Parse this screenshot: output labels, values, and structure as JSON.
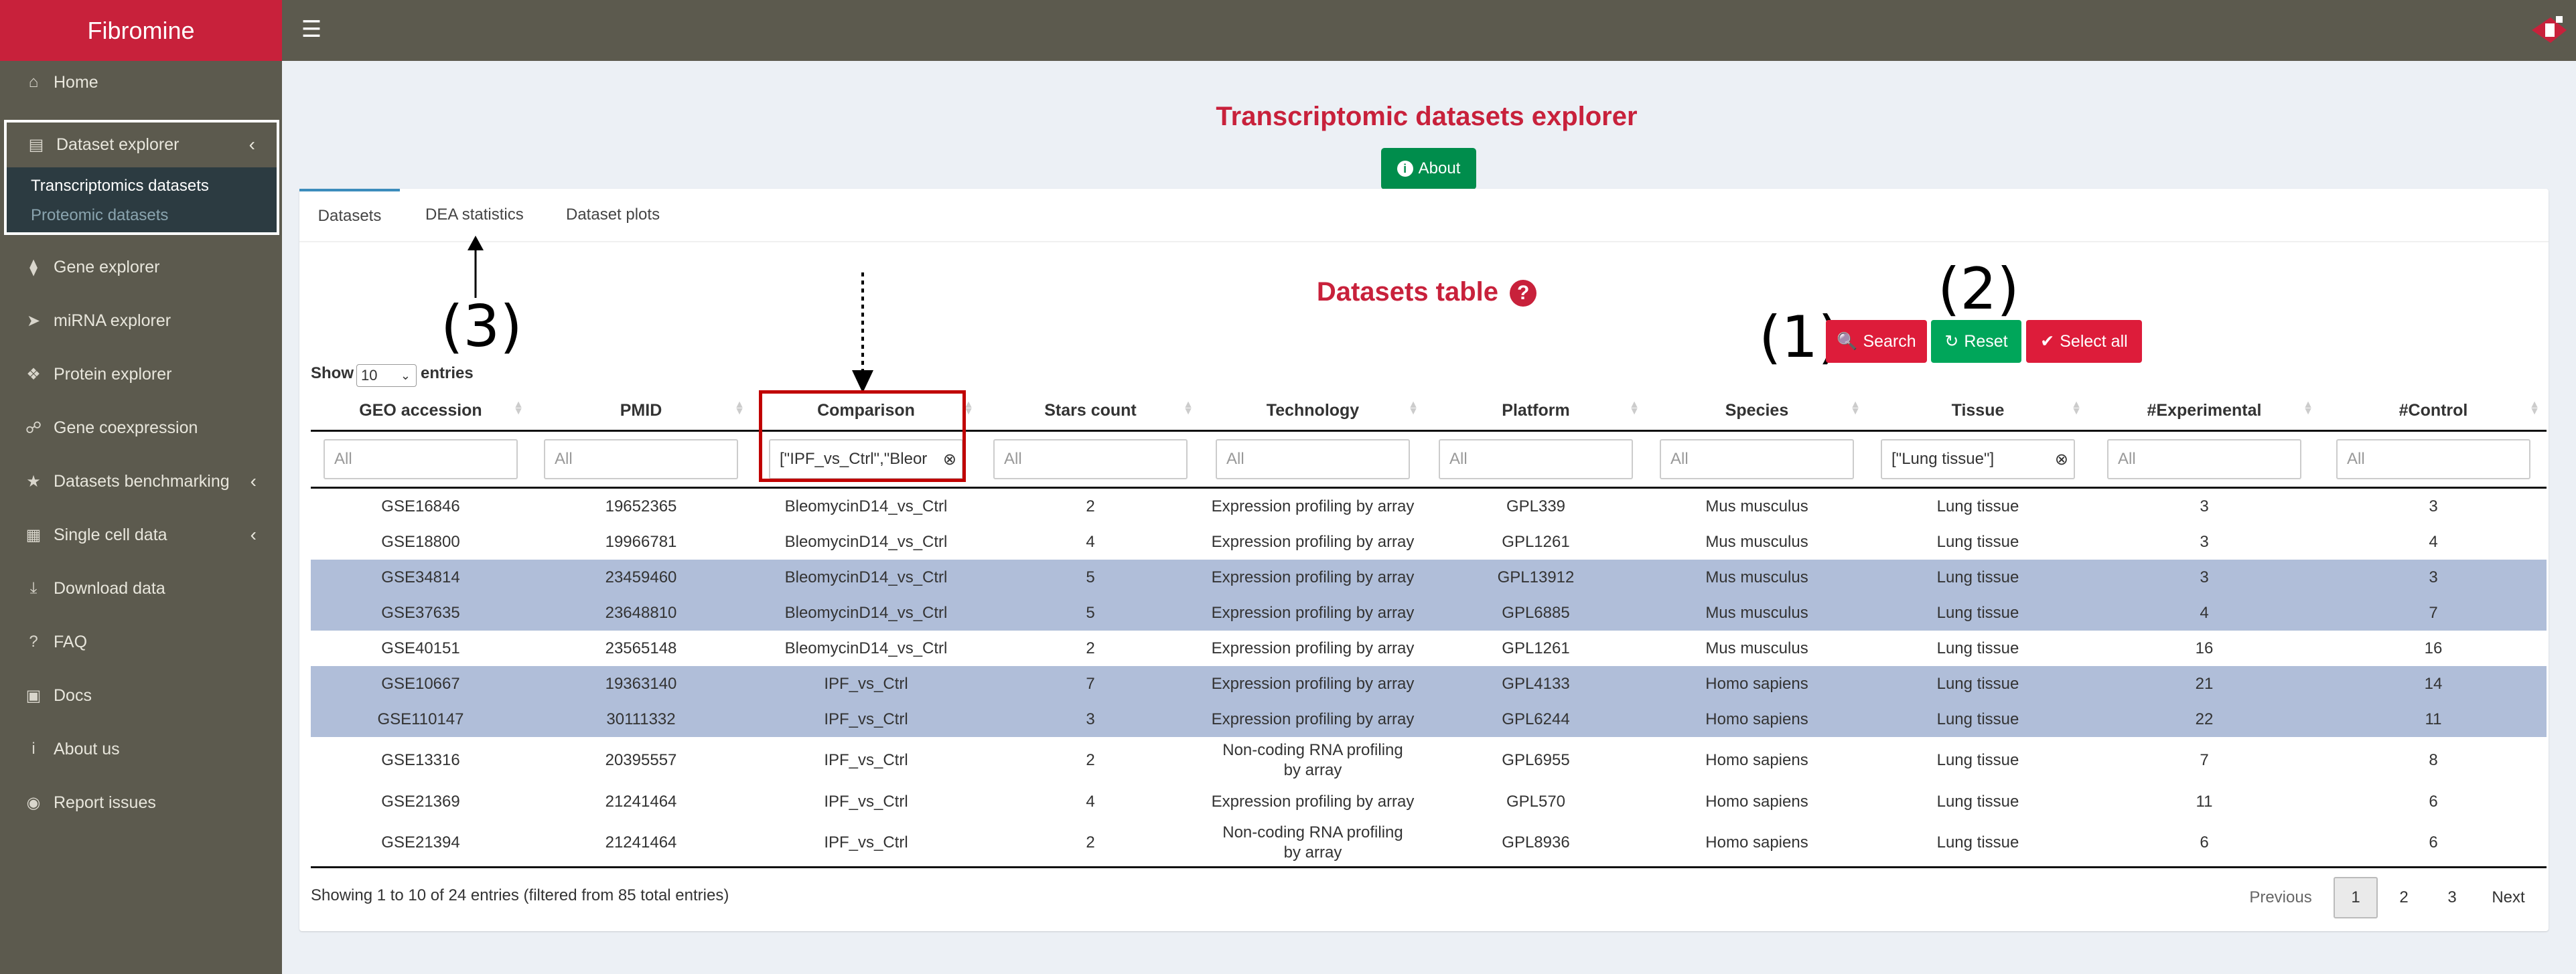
{
  "app": {
    "brand": "Fibromine"
  },
  "sidebar": {
    "items": [
      {
        "icon": "home-icon",
        "label": "Home"
      },
      {
        "icon": "database-icon",
        "label": "Dataset explorer"
      },
      {
        "icon": "dna-icon",
        "label": "Gene explorer"
      },
      {
        "icon": "mirna-icon",
        "label": "miRNA explorer"
      },
      {
        "icon": "protein-icon",
        "label": "Protein explorer"
      },
      {
        "icon": "coexpression-icon",
        "label": "Gene coexpression"
      },
      {
        "icon": "star-icon",
        "label": "Datasets benchmarking"
      },
      {
        "icon": "grid-icon",
        "label": "Single cell data"
      },
      {
        "icon": "download-icon",
        "label": "Download data"
      },
      {
        "icon": "question-icon",
        "label": "FAQ"
      },
      {
        "icon": "book-icon",
        "label": "Docs"
      },
      {
        "icon": "info-icon",
        "label": "About us"
      },
      {
        "icon": "github-icon",
        "label": "Report issues"
      }
    ],
    "subitems": [
      "Transcriptomics datasets",
      "Proteomic datasets"
    ]
  },
  "main": {
    "title": "Transcriptomic datasets explorer",
    "about_label": "About",
    "tabs": [
      "Datasets",
      "DEA statistics",
      "Dataset plots"
    ],
    "table_title": "Datasets table",
    "buttons": {
      "search": "Search",
      "reset": "Reset",
      "select_all": "Select all"
    },
    "annotations": {
      "a1": "(1)",
      "a2": "(2)",
      "a3": "(3)"
    },
    "show_label": "Show",
    "page_length": "10",
    "entries_label": "entries",
    "columns": [
      "GEO accession",
      "PMID",
      "Comparison",
      "Stars count",
      "Technology",
      "Platform",
      "Species",
      "Tissue",
      "#Experimental",
      "#Control"
    ],
    "filter_placeholder": "All",
    "filters": {
      "comparison": "[\"IPF_vs_Ctrl\",\"Bleor",
      "tissue": "[\"Lung tissue\"]"
    },
    "rows": [
      [
        "GSE16846",
        "19652365",
        "BleomycinD14_vs_Ctrl",
        "2",
        "Expression profiling by array",
        "GPL339",
        "Mus musculus",
        "Lung tissue",
        "3",
        "3"
      ],
      [
        "GSE18800",
        "19966781",
        "BleomycinD14_vs_Ctrl",
        "4",
        "Expression profiling by array",
        "GPL1261",
        "Mus musculus",
        "Lung tissue",
        "3",
        "4"
      ],
      [
        "GSE34814",
        "23459460",
        "BleomycinD14_vs_Ctrl",
        "5",
        "Expression profiling by array",
        "GPL13912",
        "Mus musculus",
        "Lung tissue",
        "3",
        "3"
      ],
      [
        "GSE37635",
        "23648810",
        "BleomycinD14_vs_Ctrl",
        "5",
        "Expression profiling by array",
        "GPL6885",
        "Mus musculus",
        "Lung tissue",
        "4",
        "7"
      ],
      [
        "GSE40151",
        "23565148",
        "BleomycinD14_vs_Ctrl",
        "2",
        "Expression profiling by array",
        "GPL1261",
        "Mus musculus",
        "Lung tissue",
        "16",
        "16"
      ],
      [
        "GSE10667",
        "19363140",
        "IPF_vs_Ctrl",
        "7",
        "Expression profiling by array",
        "GPL4133",
        "Homo sapiens",
        "Lung tissue",
        "21",
        "14"
      ],
      [
        "GSE110147",
        "30111332",
        "IPF_vs_Ctrl",
        "3",
        "Expression profiling by array",
        "GPL6244",
        "Homo sapiens",
        "Lung tissue",
        "22",
        "11"
      ],
      [
        "GSE13316",
        "20395557",
        "IPF_vs_Ctrl",
        "2",
        "Non-coding RNA profiling by array",
        "GPL6955",
        "Homo sapiens",
        "Lung tissue",
        "7",
        "8"
      ],
      [
        "GSE21369",
        "21241464",
        "IPF_vs_Ctrl",
        "4",
        "Expression profiling by array",
        "GPL570",
        "Homo sapiens",
        "Lung tissue",
        "11",
        "6"
      ],
      [
        "GSE21394",
        "21241464",
        "IPF_vs_Ctrl",
        "2",
        "Non-coding RNA profiling by array",
        "GPL8936",
        "Homo sapiens",
        "Lung tissue",
        "6",
        "6"
      ]
    ],
    "selected_rows": [
      2,
      3,
      5,
      6
    ],
    "info": "Showing 1 to 10 of 24 entries (filtered from 85 total entries)",
    "pagination": [
      "Previous",
      "1",
      "2",
      "3",
      "Next"
    ],
    "current_page": "1"
  },
  "colors": {
    "brand_red": "#c8213b",
    "sidebar_bg": "#5c5a4e",
    "success_green": "#008d4c",
    "selected_row": "#b0bed9",
    "highlight_box": "#c00000"
  }
}
